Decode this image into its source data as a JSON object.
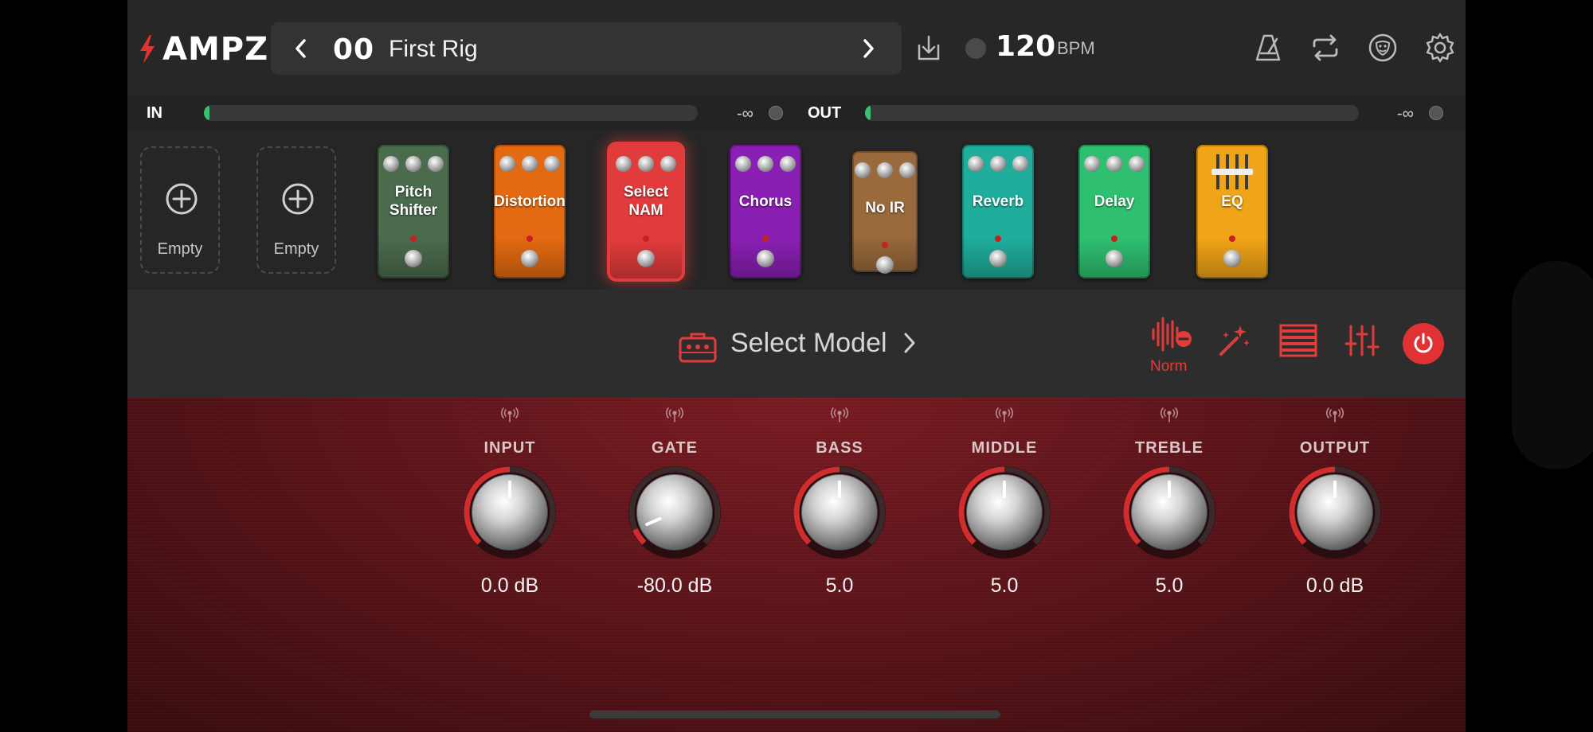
{
  "app": {
    "name": "AMPZ"
  },
  "preset": {
    "number": "00",
    "name": "First Rig"
  },
  "tempo": {
    "value": "120",
    "unit": "BPM"
  },
  "meters": {
    "in": {
      "label": "IN",
      "db": "-∞",
      "level": 0.01
    },
    "out": {
      "label": "OUT",
      "db": "-∞",
      "level": 0.01
    }
  },
  "icons": {
    "logo": "bolt-icon",
    "prev": "chevron-left-icon",
    "next": "chevron-right-icon",
    "save": "download-icon",
    "metronome": "metronome-icon",
    "loop": "loop-icon",
    "theater": "masks-icon",
    "settings": "gear-icon",
    "tuner": "tuning-fork-icon",
    "power": "power-icon"
  },
  "chain": [
    {
      "type": "empty",
      "label": "Empty"
    },
    {
      "type": "empty",
      "label": "Empty"
    },
    {
      "type": "pedal",
      "line1": "Pitch",
      "line2": "Shifter",
      "color": "#4b6b4d"
    },
    {
      "type": "pedal",
      "line1": "Distortion",
      "line2": "",
      "color": "#e36a12"
    },
    {
      "type": "pedal",
      "line1": "Select",
      "line2": "NAM",
      "color": "#e23b3b",
      "selected": true
    },
    {
      "type": "pedal",
      "line1": "Chorus",
      "line2": "",
      "color": "#8a1fb3"
    },
    {
      "type": "pedal",
      "line1": "No IR",
      "line2": "",
      "color": "#9a6a3c"
    },
    {
      "type": "pedal",
      "line1": "Reverb",
      "line2": "",
      "color": "#1fae9c"
    },
    {
      "type": "pedal",
      "line1": "Delay",
      "line2": "",
      "color": "#2ec070"
    },
    {
      "type": "pedal",
      "line1": "EQ",
      "line2": "",
      "color": "#f0a417",
      "sliders": true
    }
  ],
  "model": {
    "label": "Select Model",
    "norm_label": "Norm",
    "accent": "#e33a3a"
  },
  "knobs": [
    {
      "label": "INPUT",
      "value": "0.0 dB",
      "position": 0.5
    },
    {
      "label": "GATE",
      "value": "-80.0 dB",
      "position": 0.08
    },
    {
      "label": "BASS",
      "value": "5.0",
      "position": 0.5
    },
    {
      "label": "MIDDLE",
      "value": "5.0",
      "position": 0.5
    },
    {
      "label": "TREBLE",
      "value": "5.0",
      "position": 0.5
    },
    {
      "label": "OUTPUT",
      "value": "0.0 dB",
      "position": 0.5
    }
  ]
}
